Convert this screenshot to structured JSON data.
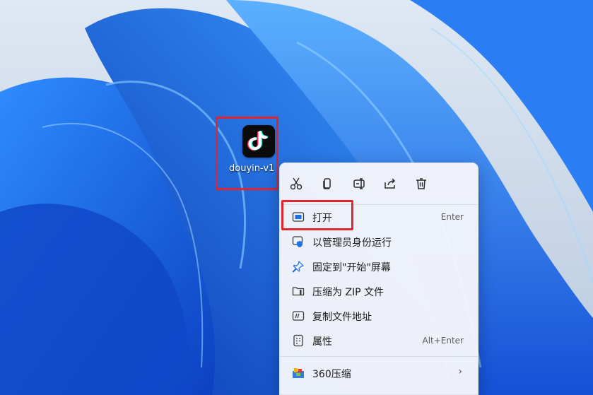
{
  "desktop": {
    "icon": {
      "label": "douyin-v1",
      "icon": "tiktok-logo-icon"
    }
  },
  "context_menu": {
    "toolbar": [
      {
        "name": "cut-icon"
      },
      {
        "name": "copy-icon"
      },
      {
        "name": "rename-icon"
      },
      {
        "name": "share-icon"
      },
      {
        "name": "delete-icon"
      }
    ],
    "items": {
      "open": {
        "label": "打开",
        "shortcut": "Enter",
        "icon": "open-window-icon"
      },
      "run_as_admin": {
        "label": "以管理员身份运行",
        "icon": "shield-admin-icon"
      },
      "pin_start": {
        "label": "固定到\"开始\"屏幕",
        "icon": "pin-icon"
      },
      "compress_zip": {
        "label": "压缩为 ZIP 文件",
        "icon": "zip-folder-icon"
      },
      "copy_path": {
        "label": "复制文件地址",
        "icon": "copy-path-icon"
      },
      "properties": {
        "label": "属性",
        "shortcut": "Alt+Enter",
        "icon": "properties-icon"
      },
      "compress_360": {
        "label": "360压缩",
        "chevron": "›",
        "icon": "360-compress-icon"
      }
    }
  },
  "colors": {
    "highlight": "#e0262c",
    "accent": "#1f6fe0"
  }
}
